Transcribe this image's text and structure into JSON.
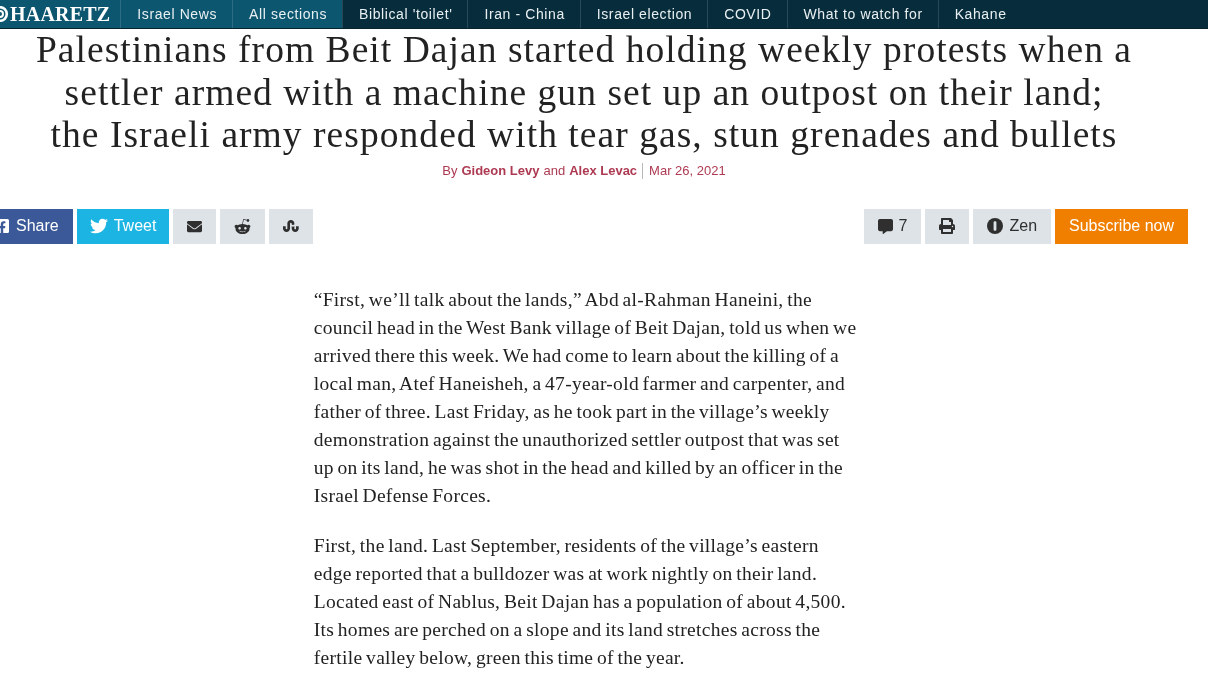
{
  "nav": {
    "logo": "HAARETZ",
    "primary_links": [
      "Israel News",
      "All sections"
    ],
    "topic_links": [
      "Biblical 'toilet'",
      "Iran - China",
      "Israel election",
      "COVID",
      "What to watch for",
      "Kahane"
    ]
  },
  "headline": "Palestinians from Beit Dajan started holding weekly protests when a\nsettler armed with a machine gun set up an outpost on their land;\nthe Israeli army responded with tear gas, stun grenades and bullets",
  "byline": {
    "prefix": "By",
    "authors": [
      "Gideon Levy",
      "Alex Levac"
    ],
    "conjunction": "and",
    "date": "Mar 26, 2021"
  },
  "share_buttons": [
    {
      "kind": "facebook",
      "label": "Share"
    },
    {
      "kind": "twitter",
      "label": "Tweet"
    },
    {
      "kind": "email"
    },
    {
      "kind": "reddit"
    },
    {
      "kind": "stumbleupon"
    }
  ],
  "tools": [
    {
      "kind": "comments",
      "label": "7"
    },
    {
      "kind": "print"
    },
    {
      "kind": "zen",
      "label": "Zen"
    }
  ],
  "subscribe_button": "Subscribe now",
  "paragraphs": [
    "“First, we’ll talk about the lands,” Abd al-Rahman Haneini, the council head in the West Bank village of Beit Dajan, told us when we arrived there this week. We had come to learn about the killing of a local man, Atef Haneisheh, a 47-year-old farmer and carpenter, and father of three. Last Friday, as he took part in the village’s weekly demonstration against the unauthorized settler outpost that was set up on its land, he was shot in the head and killed by an officer in the Israel Defense Forces.",
    "First, the land. Last September, residents of the village’s eastern edge reported that a bulldozer was at work nightly on their land. Located east of Nablus, Beit Dajan has a population of about 4,500. Its homes are perched on a slope and its land stretches across the fertile valley below, green this time of the year."
  ]
}
